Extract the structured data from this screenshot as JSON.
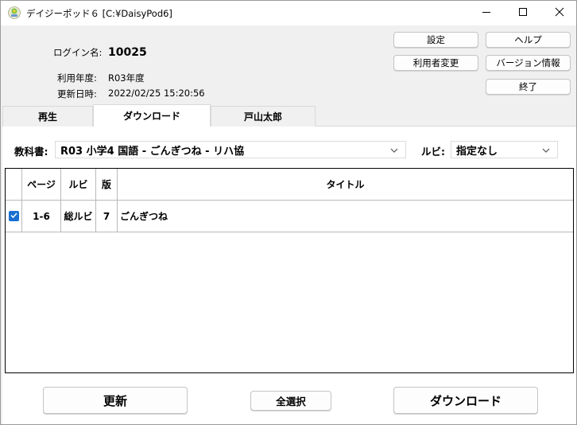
{
  "window": {
    "title": "デイジーポッド６ [C:¥DaisyPod6]",
    "controls": {
      "minimize": "minimize-icon",
      "maximize": "maximize-icon",
      "close": "close-icon"
    }
  },
  "header": {
    "login_label": "ログイン名:",
    "login_value": "10025",
    "year_label": "利用年度:",
    "year_value": "R03年度",
    "updated_label": "更新日時:",
    "updated_value": "2022/02/25 15:20:56"
  },
  "buttons": {
    "settings": "設定",
    "help": "ヘルプ",
    "change_user": "利用者変更",
    "version_info": "バージョン情報",
    "exit": "終了",
    "refresh": "更新",
    "select_all": "全選択",
    "download": "ダウンロード"
  },
  "tabs": [
    {
      "label": "再生",
      "active": false
    },
    {
      "label": "ダウンロード",
      "active": true
    },
    {
      "label": "戸山太郎",
      "active": false
    }
  ],
  "filters": {
    "textbook_label": "教科書:",
    "textbook_value": "R03 小学4 国語 - ごんぎつね - リハ協",
    "ruby_label": "ルビ:",
    "ruby_value": "指定なし"
  },
  "table": {
    "columns": [
      "",
      "ページ",
      "ルビ",
      "版",
      "タイトル"
    ],
    "rows": [
      {
        "checked": true,
        "page": "1-6",
        "ruby": "総ルビ",
        "edition": "7",
        "title": "ごんぎつね"
      }
    ]
  },
  "colors": {
    "accent": "#1a6fd0",
    "background": "#f0f0f0"
  }
}
